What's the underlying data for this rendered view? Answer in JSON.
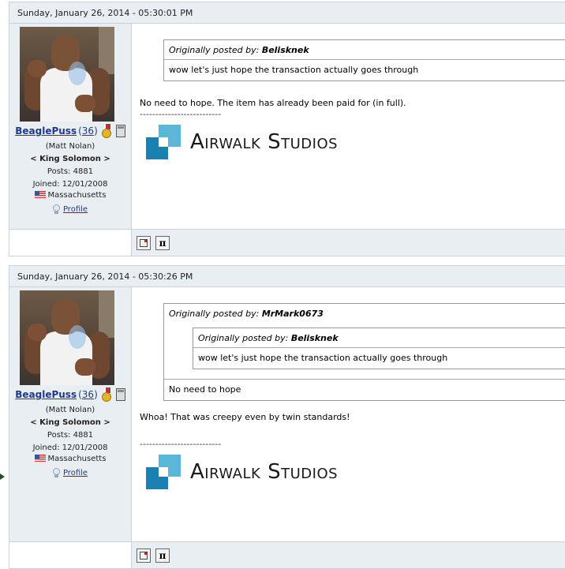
{
  "posts": [
    {
      "date": "Sunday, January 26, 2014 - 05:30:01 PM",
      "user": {
        "username": "BeaglePuss",
        "rep_open": "(",
        "rep": "36",
        "rep_close": ")",
        "real_name": "(Matt Nolan)",
        "title": "< King Solomon >",
        "posts": "Posts: 4881",
        "joined": "Joined: 12/01/2008",
        "location": "Massachusetts",
        "profile_label": "Profile"
      },
      "quote": {
        "prefix": "Originally posted by:",
        "author": "Belisknek",
        "text": "wow let's just hope the transaction actually goes through"
      },
      "message": "No need to hope.  The item has already been paid for (in full).",
      "signature_line": "--------------------------",
      "signature_logo": "Airwalk Studios"
    },
    {
      "date": "Sunday, January 26, 2014 - 05:30:26 PM",
      "user": {
        "username": "BeaglePuss",
        "rep_open": "(",
        "rep": "36",
        "rep_close": ")",
        "real_name": "(Matt Nolan)",
        "title": "< King Solomon >",
        "posts": "Posts: 4881",
        "joined": "Joined: 12/01/2008",
        "location": "Massachusetts",
        "profile_label": "Profile"
      },
      "quote": {
        "prefix": "Originally posted by:",
        "author": "MrMark0673",
        "nested": {
          "prefix": "Originally posted by:",
          "author": "Belisknek",
          "text": "wow let's just hope the transaction actually goes through"
        },
        "text": "No need to hope"
      },
      "message": "Whoa!  That was creepy even by twin standards!",
      "signature_line": "--------------------------",
      "signature_logo": "Airwalk Studios"
    }
  ],
  "footer_buttons": {
    "inbox_icon": "private-message-icon",
    "pi_label": "π"
  }
}
